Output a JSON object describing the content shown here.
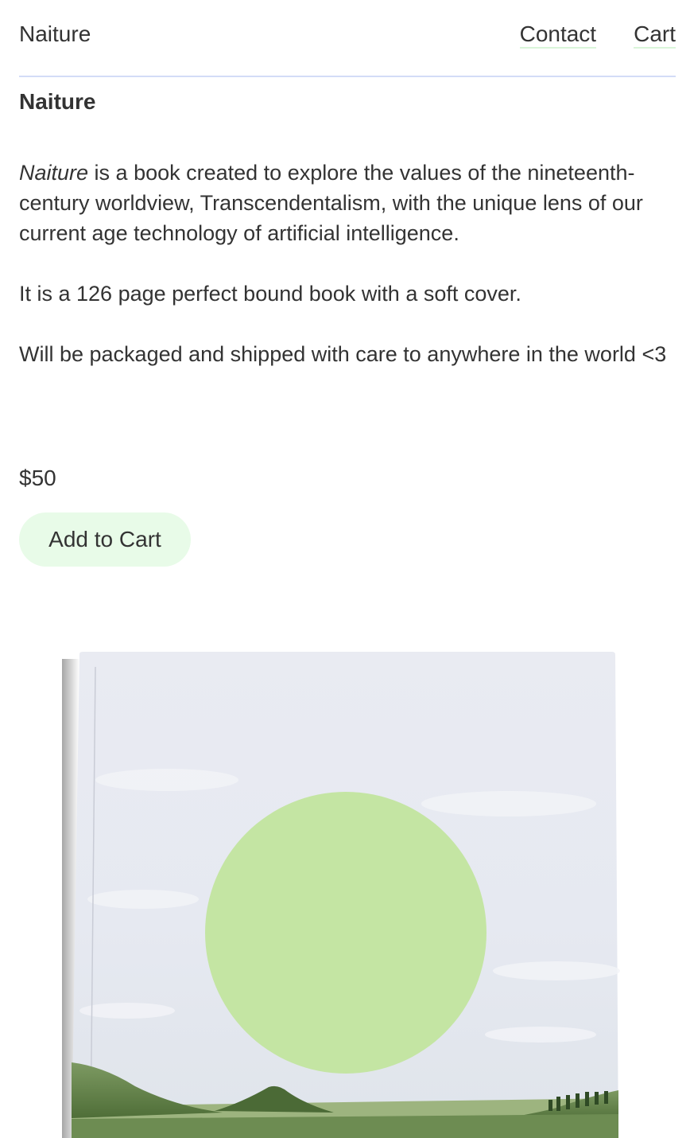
{
  "header": {
    "brand": "Naiture",
    "nav": {
      "contact": "Contact",
      "cart": "Cart"
    }
  },
  "product": {
    "title": "Naiture",
    "description": {
      "title_italic": "Naiture",
      "para1_rest": " is a book created to explore the values of the nineteenth-century worldview, Transcendentalism, with the unique lens of our current age technology of artificial intelligence.",
      "para2": "It is a 126 page perfect bound book with a soft cover.",
      "para3": "Will be packaged and shipped with care to anywhere in the world <3"
    },
    "price": "$50",
    "add_to_cart_label": "Add to Cart",
    "image": {
      "alt": "Naiture book cover: sky with a green circle over a grassy landscape",
      "colors": {
        "sky": "#e6e9f1",
        "circle": "#c4e5a3",
        "grass": "#5e7e45"
      }
    }
  },
  "theme": {
    "accent_button": "#e8fbe8",
    "header_rule": "#d3dcf7",
    "nav_underline": "#d9f5d9"
  }
}
